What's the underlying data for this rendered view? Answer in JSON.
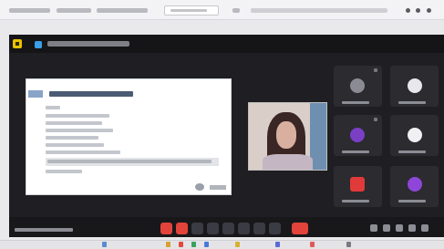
{
  "browser": {
    "url_placeholder": ""
  },
  "meeting": {
    "title": "",
    "shared_slide": {
      "title": ""
    },
    "participants": [
      {
        "avatar_color": "#8b8b93"
      },
      {
        "avatar_color": "#e8e8ec"
      },
      {
        "avatar_color": "#7a3fc4"
      },
      {
        "avatar_color": "#f0f0f2"
      },
      {
        "avatar_color": "#e03a3a"
      },
      {
        "avatar_color": "#8e46d8"
      }
    ]
  },
  "toolbar": {
    "left_status": "",
    "buttons": [
      {
        "icon": "camera-icon",
        "color": "#e2433a"
      },
      {
        "icon": "microphone-icon",
        "color": "#e2433a"
      },
      {
        "icon": "share-screen-icon",
        "color": "#3b3b44"
      },
      {
        "icon": "record-icon",
        "color": "#3b3b44"
      },
      {
        "icon": "chat-icon",
        "color": "#3b3b44"
      },
      {
        "icon": "participants-icon",
        "color": "#3b3b44"
      },
      {
        "icon": "reactions-icon",
        "color": "#3b3b44"
      },
      {
        "icon": "more-icon",
        "color": "#3b3b44"
      },
      {
        "icon": "leave-call-icon",
        "color": "#e2433a"
      }
    ]
  },
  "colors": {
    "meeting_background": "#1f1f23",
    "accent": "#e8c200",
    "danger": "#e2433a"
  }
}
